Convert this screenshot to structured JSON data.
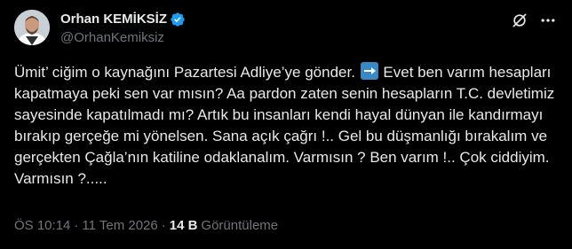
{
  "author": {
    "display_name": "Orhan KEMİKSİZ",
    "handle": "@OrhanKemiksiz",
    "verified": true,
    "avatar_icon": "profile-photo"
  },
  "icons": {
    "verified": "verified-badge-icon",
    "grok": "grok-icon",
    "more": "more-icon",
    "arrow_emoji": "right-arrow-emoji"
  },
  "tweet": {
    "text_part1": "Ümit’ ciğim  o kaynağını Pazartesi Adliye’ye gönder.",
    "text_part2": "Evet ben varım hesapları kapatmaya peki sen var mısın? Aa pardon zaten senin hesapların T.C. devletimiz sayesinde kapatılmadı mı? Artık bu insanları kendi hayal dünyan ile kandırmayı bırakıp gerçeğe mi yönelsen. Sana açık çağrı !.. Gel bu düşmanlığı bırakalım ve gerçekten Çağla’nın katiline odaklanalım. Varmısın ? Ben varım !.. Çok ciddiyim. Varmısın ?....."
  },
  "meta": {
    "time": "ÖS 10:14",
    "separator": "·",
    "date": "11 Tem 2026",
    "views_count": "14 B",
    "views_label": "Görüntüleme"
  },
  "colors": {
    "background": "#000000",
    "text_primary": "#e7e9ea",
    "text_secondary": "#71767b",
    "verified_blue": "#1d9bf0",
    "arrow_emoji_blue": "#3b88c3"
  }
}
